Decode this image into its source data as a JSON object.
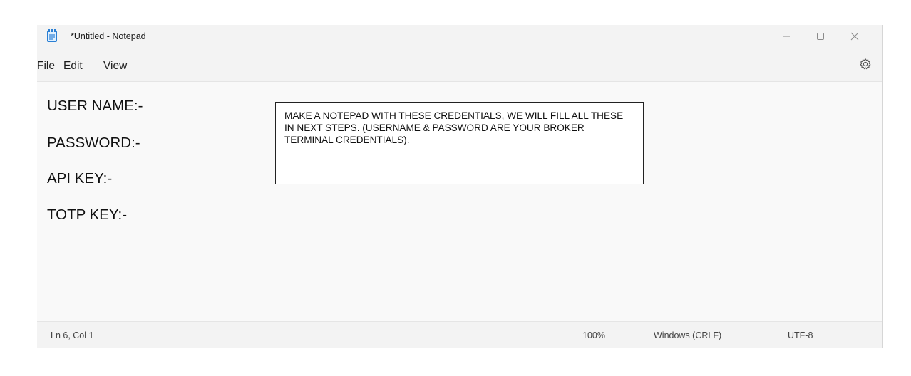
{
  "window": {
    "title": "*Untitled - Notepad"
  },
  "menu": {
    "file": "File",
    "edit": "Edit",
    "view": "View"
  },
  "editor": {
    "lines": [
      "USER NAME:-",
      "PASSWORD:-",
      "API KEY:-",
      "TOTP KEY:-"
    ]
  },
  "callout": {
    "text": "MAKE A NOTEPAD WITH THESE CREDENTIALS, WE WILL FILL ALL THESE IN NEXT STEPS. (USERNAME & PASSWORD ARE YOUR BROKER TERMINAL CREDENTIALS)."
  },
  "status": {
    "position": "Ln 6, Col 1",
    "zoom": "100%",
    "line_ending": "Windows (CRLF)",
    "encoding": "UTF-8"
  },
  "icons": {
    "app": "notepad-icon",
    "minimize": "minimize-icon",
    "maximize": "maximize-icon",
    "close": "close-icon",
    "settings": "gear-icon"
  },
  "colors": {
    "titlebar": "#f3f3f3",
    "editor_bg": "#f9f9f9",
    "text": "#111111",
    "app_icon_accent": "#2a7fd4"
  }
}
